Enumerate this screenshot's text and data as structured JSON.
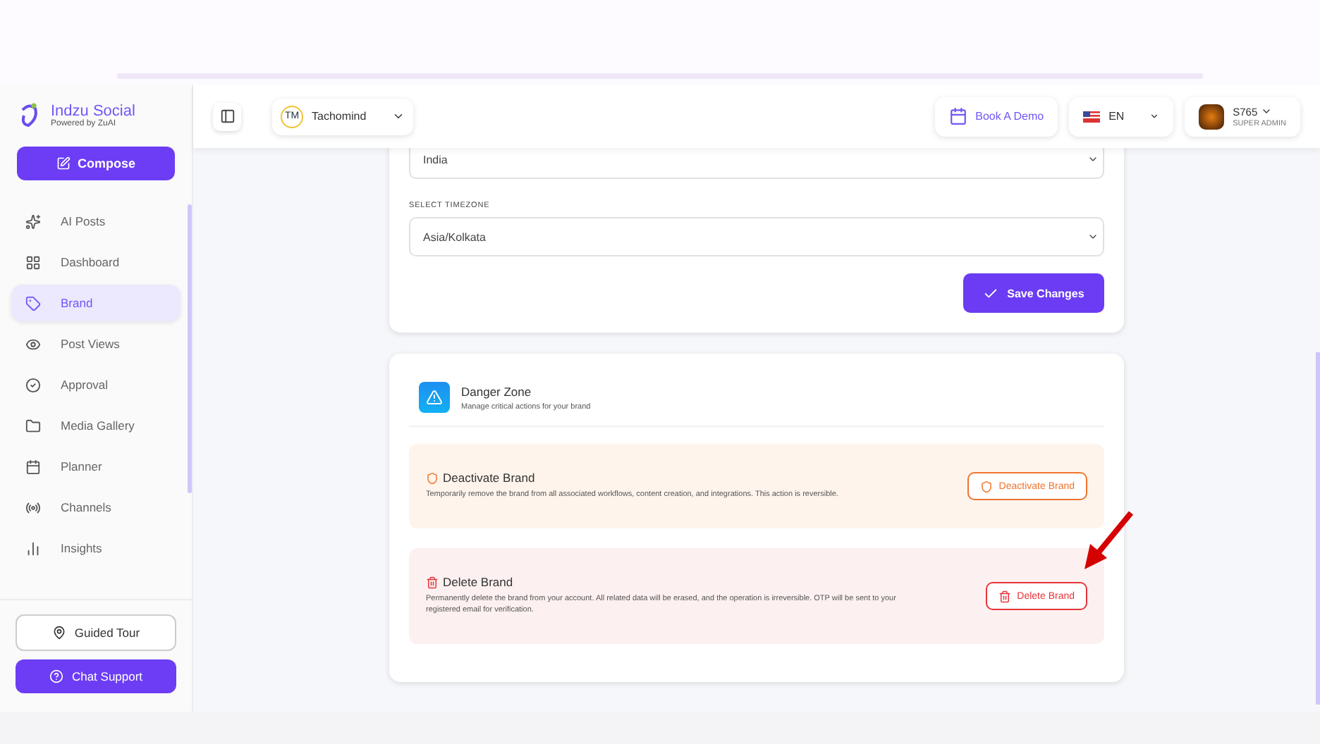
{
  "brand": {
    "name": "Indzu Social",
    "tagline": "Powered by ZuAI"
  },
  "compose_button": "Compose",
  "nav": [
    {
      "label": "AI Posts",
      "selected": false
    },
    {
      "label": "Dashboard",
      "selected": false
    },
    {
      "label": "Brand",
      "selected": true
    },
    {
      "label": "Post Views",
      "selected": false
    },
    {
      "label": "Approval",
      "selected": false
    },
    {
      "label": "Media Gallery",
      "selected": false
    },
    {
      "label": "Planner",
      "selected": false
    },
    {
      "label": "Channels",
      "selected": false
    },
    {
      "label": "Insights",
      "selected": false
    }
  ],
  "sidebar_footer": {
    "tour_button": "Guided Tour",
    "support_button": "Chat Support"
  },
  "header": {
    "workspace": {
      "initials": "TM",
      "name": "Tachomind"
    },
    "demo_button": "Book A Demo",
    "language": "EN",
    "user": {
      "name": "S765",
      "role": "SUPER ADMIN"
    }
  },
  "settings_card": {
    "country_value": "India",
    "timezone_label": "SELECT TIMEZONE",
    "timezone_value": "Asia/Kolkata",
    "save_button": "Save Changes"
  },
  "danger_zone": {
    "title": "Danger Zone",
    "subtitle": "Manage critical actions for your brand",
    "actions": [
      {
        "kind": "deactivate",
        "title": "Deactivate Brand",
        "description": "Temporarily remove the brand from all associated workflows, content creation, and integrations. This action is reversible.",
        "button": "Deactivate Brand"
      },
      {
        "kind": "delete",
        "title": "Delete Brand",
        "description": "Permanently delete the brand from your account. All related data will be erased, and the operation is irreversible. OTP will be sent to your registered email for verification.",
        "button": "Delete Brand"
      }
    ]
  }
}
